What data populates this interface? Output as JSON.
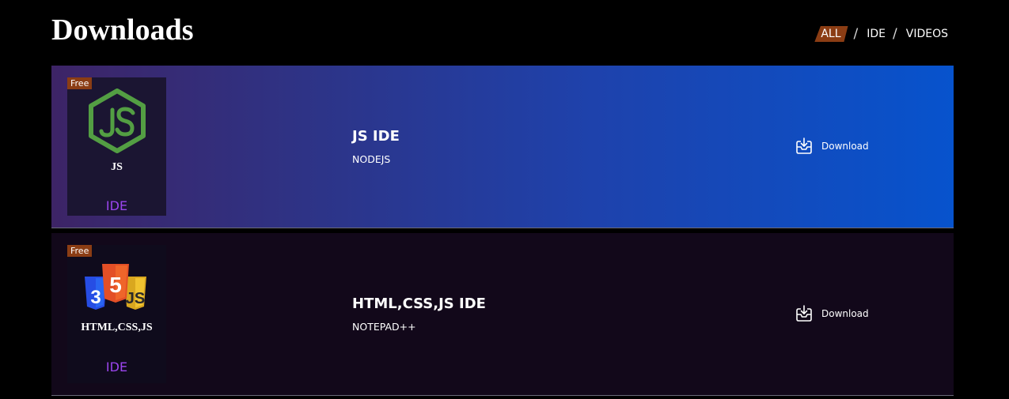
{
  "page": {
    "title": "Downloads"
  },
  "filters": {
    "items": [
      {
        "label": "ALL",
        "active": true
      },
      {
        "label": "IDE",
        "active": false
      },
      {
        "label": "VIDEOS",
        "active": false
      }
    ],
    "separator": "/",
    "active_color": "#8b3d14"
  },
  "downloads": [
    {
      "badge": "Free",
      "icon": "nodejs-logo",
      "thumb_name": "JS",
      "thumb_category": "IDE",
      "title": "JS IDE",
      "subtitle": "NODEJS",
      "action": "Download"
    },
    {
      "badge": "Free",
      "icon": "html-css-js-logos",
      "thumb_name": "HTML,CSS,JS",
      "thumb_category": "IDE",
      "title": "HTML,CSS,JS IDE",
      "subtitle": "NOTEPAD++",
      "action": "Download"
    }
  ],
  "colors": {
    "badge": "#8b3d14",
    "category": "#9b45ee",
    "node_green": "#539e43",
    "gradient_end": "#0753cd"
  }
}
